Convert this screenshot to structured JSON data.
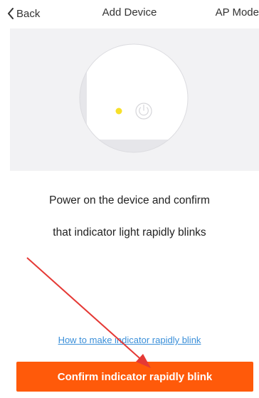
{
  "nav": {
    "back_label": "Back",
    "title": "Add Device",
    "mode_label": "AP Mode"
  },
  "instruction": {
    "line1": "Power on the device and confirm",
    "line2": "that indicator light rapidly blinks"
  },
  "help_link": "How to make indicator rapidly blink",
  "confirm_button": "Confirm indicator rapidly blink",
  "colors": {
    "accent": "#ff5a0a",
    "link": "#3a8fd9",
    "indicator": "#f7e02a",
    "annotation_arrow": "#e53935"
  }
}
